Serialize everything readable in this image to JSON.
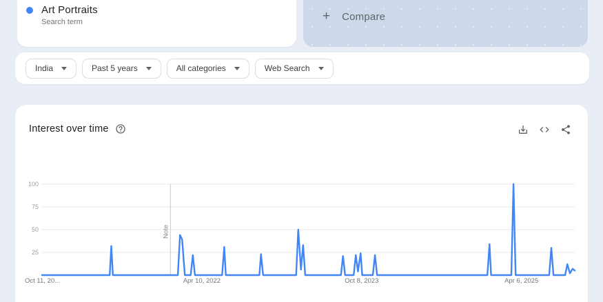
{
  "page": {
    "background": "#e9edf6"
  },
  "term_card": {
    "term": "Art Portraits",
    "subtitle": "Search term",
    "dot_color": "#4285f4"
  },
  "compare_card": {
    "plus": "+",
    "label": "Compare"
  },
  "filters": [
    {
      "id": "geo",
      "label": "India"
    },
    {
      "id": "time",
      "label": "Past 5 years"
    },
    {
      "id": "category",
      "label": "All categories"
    },
    {
      "id": "property",
      "label": "Web Search"
    }
  ],
  "chart_card": {
    "title": "Interest over time"
  },
  "chart_data": {
    "type": "line",
    "title": "Interest over time",
    "ylim": [
      0,
      100
    ],
    "yticks": [
      25,
      50,
      75,
      100
    ],
    "grid_on": true,
    "grid_color": "#e8e8e8",
    "y_label_color": "#9aa0a6",
    "x_label_color": "#70757a",
    "note_line_color": "#c8c9cc",
    "xticks": [
      {
        "label": "Oct 11, 20...",
        "x": 0.0,
        "align": "start"
      },
      {
        "label": "Apr 10, 2022",
        "x": 0.3,
        "align": "middle"
      },
      {
        "label": "Oct 8, 2023",
        "x": 0.6,
        "align": "middle"
      },
      {
        "label": "Apr 6, 2025",
        "x": 0.9,
        "align": "middle"
      }
    ],
    "note": {
      "label": "Note",
      "x": 0.241
    },
    "series": [
      {
        "name": "Art Portraits",
        "color": "#4285f4",
        "points": [
          [
            0.0,
            0
          ],
          [
            0.127,
            0
          ],
          [
            0.13,
            32
          ],
          [
            0.133,
            0
          ],
          [
            0.255,
            0
          ],
          [
            0.259,
            44
          ],
          [
            0.263,
            39
          ],
          [
            0.268,
            0
          ],
          [
            0.279,
            0
          ],
          [
            0.283,
            22
          ],
          [
            0.287,
            0
          ],
          [
            0.338,
            0
          ],
          [
            0.342,
            31
          ],
          [
            0.345,
            0
          ],
          [
            0.408,
            0
          ],
          [
            0.411,
            23
          ],
          [
            0.415,
            0
          ],
          [
            0.477,
            0
          ],
          [
            0.481,
            50
          ],
          [
            0.486,
            6
          ],
          [
            0.49,
            33
          ],
          [
            0.494,
            0
          ],
          [
            0.561,
            0
          ],
          [
            0.565,
            21
          ],
          [
            0.569,
            0
          ],
          [
            0.585,
            0
          ],
          [
            0.589,
            22
          ],
          [
            0.593,
            4
          ],
          [
            0.598,
            24
          ],
          [
            0.601,
            0
          ],
          [
            0.621,
            0
          ],
          [
            0.625,
            22
          ],
          [
            0.629,
            0
          ],
          [
            0.836,
            0
          ],
          [
            0.84,
            34
          ],
          [
            0.843,
            0
          ],
          [
            0.881,
            0
          ],
          [
            0.885,
            100
          ],
          [
            0.889,
            0
          ],
          [
            0.952,
            0
          ],
          [
            0.956,
            30
          ],
          [
            0.96,
            0
          ],
          [
            0.982,
            0
          ],
          [
            0.986,
            12
          ],
          [
            0.991,
            2
          ],
          [
            0.996,
            7
          ],
          [
            1.0,
            5
          ]
        ]
      }
    ]
  }
}
